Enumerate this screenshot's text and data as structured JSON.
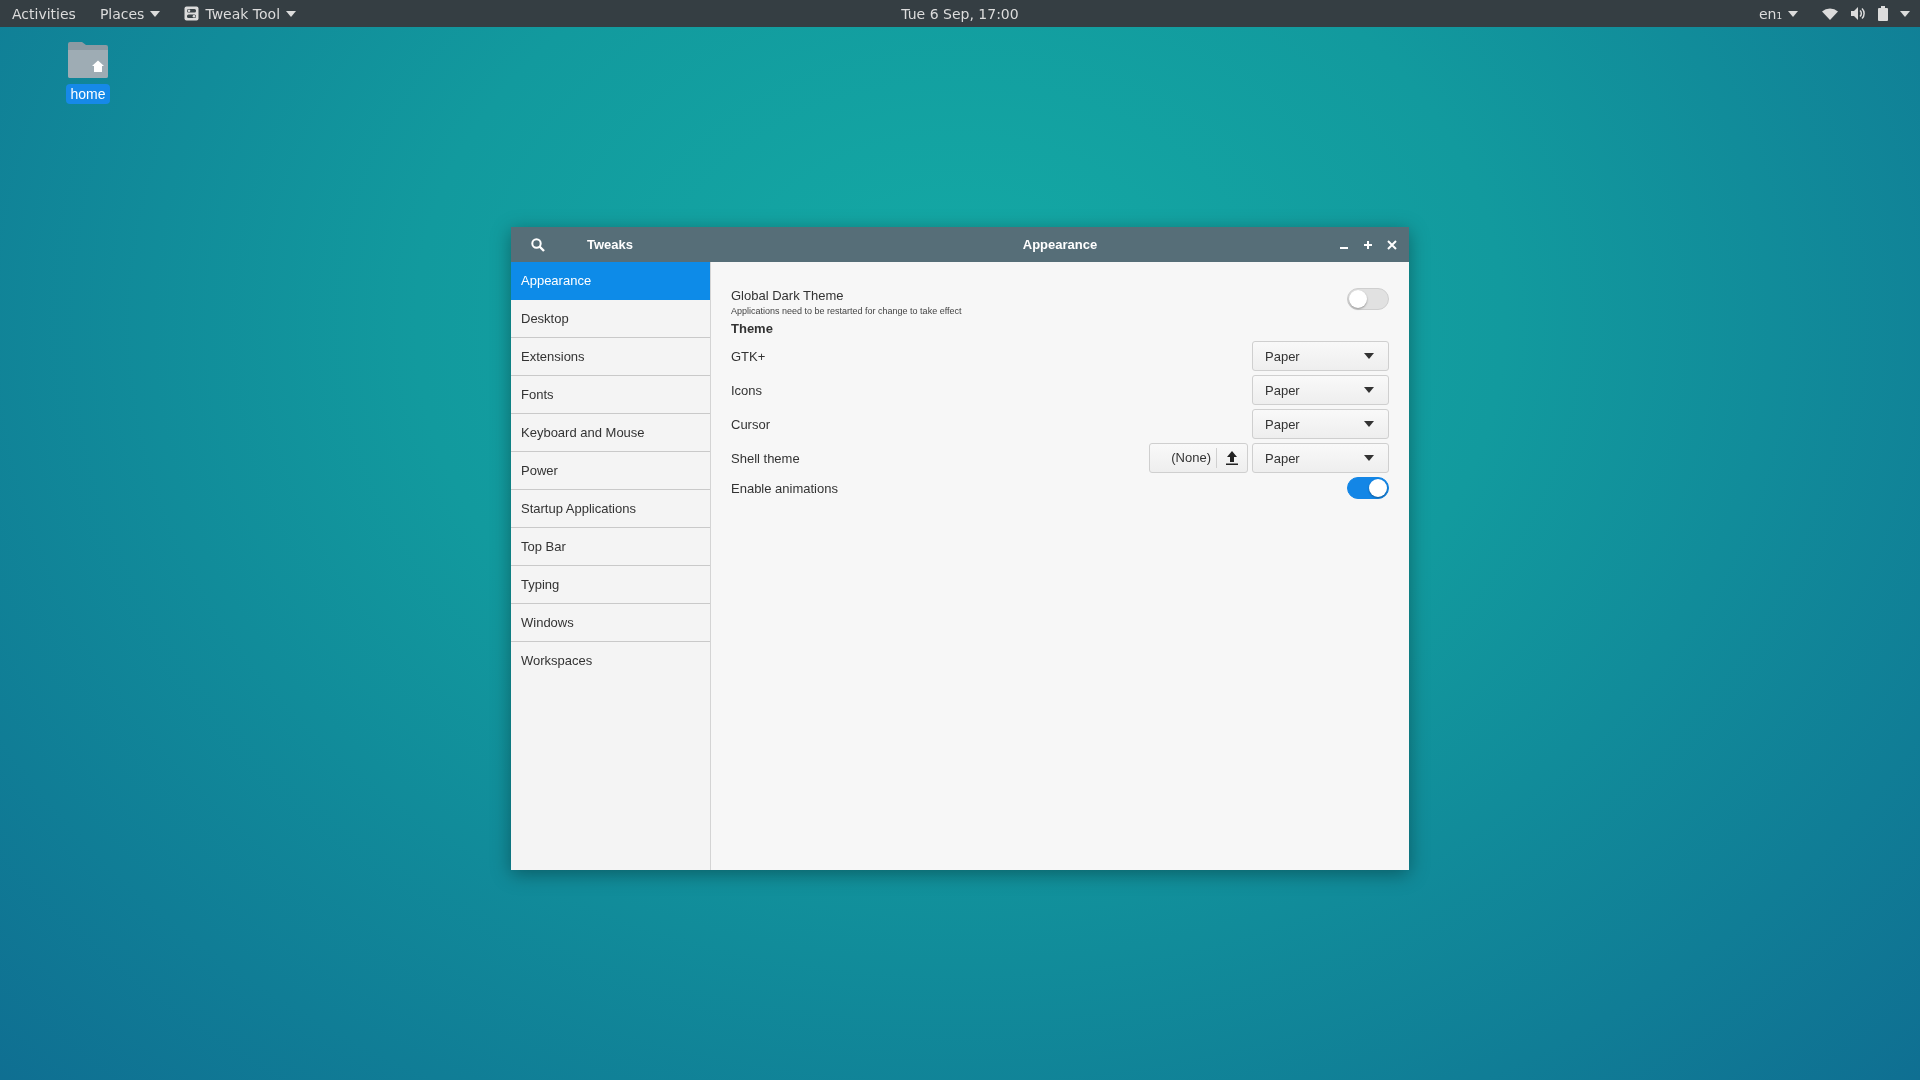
{
  "top_bar": {
    "activities": "Activities",
    "places": "Places",
    "app_menu": "Tweak Tool",
    "clock": "Tue  6 Sep, 17:00",
    "keyboard": "en₁"
  },
  "desktop_icons": [
    {
      "label": "home",
      "selected": true
    }
  ],
  "window": {
    "title": "Tweaks",
    "page_title": "Appearance",
    "sidebar": {
      "items": [
        {
          "label": "Appearance",
          "selected": true
        },
        {
          "label": "Desktop",
          "selected": false
        },
        {
          "label": "Extensions",
          "selected": false
        },
        {
          "label": "Fonts",
          "selected": false
        },
        {
          "label": "Keyboard and Mouse",
          "selected": false
        },
        {
          "label": "Power",
          "selected": false
        },
        {
          "label": "Startup Applications",
          "selected": false
        },
        {
          "label": "Top Bar",
          "selected": false
        },
        {
          "label": "Typing",
          "selected": false
        },
        {
          "label": "Windows",
          "selected": false
        },
        {
          "label": "Workspaces",
          "selected": false
        }
      ]
    },
    "settings": [
      {
        "kind": "switch",
        "label": "Global Dark Theme",
        "note": "Applications need to be restarted for change to take effect",
        "on": false
      },
      {
        "kind": "heading",
        "label": "Theme"
      },
      {
        "kind": "combo",
        "label": "GTK+",
        "value": "Paper"
      },
      {
        "kind": "combo",
        "label": "Icons",
        "value": "Paper"
      },
      {
        "kind": "combo",
        "label": "Cursor",
        "value": "Paper"
      },
      {
        "kind": "combo",
        "label": "Shell theme",
        "value": "Paper",
        "file_button": "(None)"
      },
      {
        "kind": "switch",
        "label": "Enable animations",
        "on": true
      }
    ]
  }
}
